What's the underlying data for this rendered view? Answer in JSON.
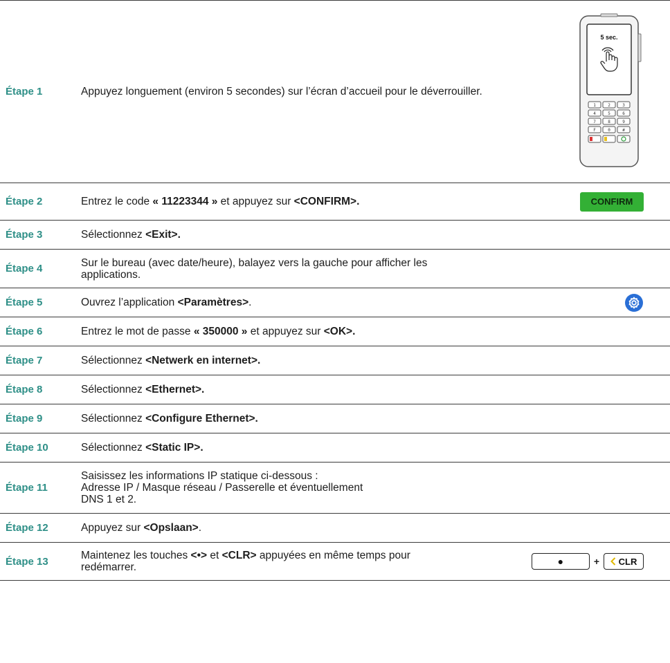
{
  "steps": [
    {
      "label": "Étape 1",
      "parts": [
        {
          "t": "Appuyez longuement (environ 5 secondes) sur l’écran d’accueil pour le déverrouiller."
        }
      ]
    },
    {
      "label": "Étape 2",
      "parts": [
        {
          "t": "Entrez le code "
        },
        {
          "t": "« 11223344 »",
          "b": true
        },
        {
          "t": " et appuyez sur "
        },
        {
          "t": "<CONFIRM>.",
          "b": true
        }
      ]
    },
    {
      "label": "Étape 3",
      "parts": [
        {
          "t": "Sélectionnez "
        },
        {
          "t": "<Exit>.",
          "b": true
        }
      ]
    },
    {
      "label": "Étape 4",
      "parts": [
        {
          "t": "Sur le bureau (avec date/heure), balayez vers la gauche pour afficher les applications."
        }
      ]
    },
    {
      "label": "Étape 5",
      "parts": [
        {
          "t": "Ouvrez l’application "
        },
        {
          "t": "<Paramètres>",
          "b": true
        },
        {
          "t": "."
        }
      ]
    },
    {
      "label": "Étape 6",
      "parts": [
        {
          "t": "Entrez le mot de passe "
        },
        {
          "t": "« 350000 »",
          "b": true
        },
        {
          "t": " et appuyez sur "
        },
        {
          "t": "<OK>.",
          "b": true
        }
      ]
    },
    {
      "label": "Étape 7",
      "parts": [
        {
          "t": "Sélectionnez "
        },
        {
          "t": "<Netwerk en internet>.",
          "b": true
        }
      ]
    },
    {
      "label": "Étape 8",
      "parts": [
        {
          "t": "Sélectionnez "
        },
        {
          "t": "<Ethernet>.",
          "b": true
        }
      ]
    },
    {
      "label": "Étape 9",
      "parts": [
        {
          "t": "Sélectionnez "
        },
        {
          "t": "<Configure Ethernet>.",
          "b": true
        }
      ]
    },
    {
      "label": "Étape 10",
      "parts": [
        {
          "t": "Sélectionnez "
        },
        {
          "t": "<Static IP>.",
          "b": true
        }
      ]
    },
    {
      "label": "Étape 11",
      "parts": [
        {
          "t": "Saisissez les informations IP statique ci-dessous :"
        },
        {
          "br": true
        },
        {
          "t": "Adresse IP / Masque réseau / Passerelle et éventuellement"
        },
        {
          "br": true
        },
        {
          "t": "DNS 1 et 2."
        }
      ]
    },
    {
      "label": "Étape 12",
      "parts": [
        {
          "t": "Appuyez sur "
        },
        {
          "t": "<Opslaan>",
          "b": true
        },
        {
          "t": "."
        }
      ]
    },
    {
      "label": "Étape 13",
      "parts": [
        {
          "t": "Maintenez les touches "
        },
        {
          "t": "<•>",
          "b": true
        },
        {
          "t": " et "
        },
        {
          "t": "<CLR>",
          "b": true
        },
        {
          "t": " appuyées en même temps pour redémarrer."
        }
      ]
    }
  ],
  "terminal": {
    "screen_text": "5 sec."
  },
  "confirm_button": {
    "label": "CONFIRM"
  },
  "keys": {
    "dot_label": "●",
    "plus": "+",
    "clr_label": "CLR"
  },
  "colors": {
    "step_label": "#2e8f87",
    "confirm_green": "#33b035",
    "gear_blue": "#2a6fd6"
  }
}
